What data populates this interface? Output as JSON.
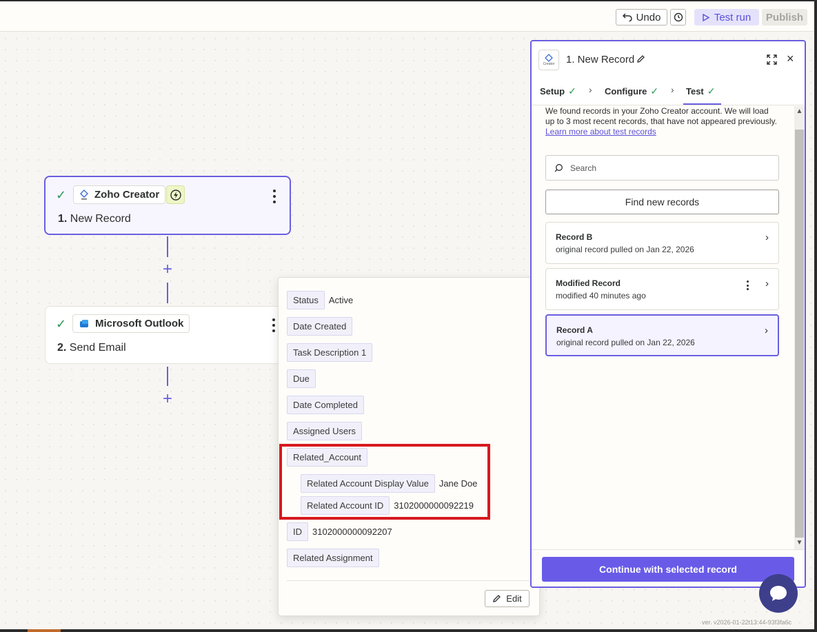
{
  "toolbar": {
    "undo_label": "Undo",
    "test_run_label": "Test run",
    "publish_label": "Publish"
  },
  "steps": [
    {
      "app_name": "Zoho Creator",
      "number": "1.",
      "title": "New Record"
    },
    {
      "app_name": "Microsoft Outlook",
      "number": "2.",
      "title": "Send Email"
    }
  ],
  "popover": {
    "fields": [
      {
        "label": "Status",
        "value": "Active"
      },
      {
        "label": "Date Created",
        "value": ""
      },
      {
        "label": "Task Description 1",
        "value": ""
      },
      {
        "label": "Due",
        "value": ""
      },
      {
        "label": "Date Completed",
        "value": ""
      },
      {
        "label": "Assigned Users",
        "value": ""
      },
      {
        "label": "Related_Account",
        "value": ""
      },
      {
        "label": "Related Account Display Value",
        "value": "Jane Doe"
      },
      {
        "label": "Related Account ID",
        "value": "3102000000092219"
      },
      {
        "label": "ID",
        "value": "3102000000092207"
      },
      {
        "label": "Related Assignment",
        "value": ""
      }
    ],
    "edit_label": "Edit"
  },
  "panel": {
    "app_logo_text": "Creator",
    "title": "1. New Record",
    "tabs": [
      {
        "label": "Setup"
      },
      {
        "label": "Configure"
      },
      {
        "label": "Test"
      }
    ],
    "intro_text": "We found records in your Zoho Creator account. We will load up to 3 most recent records, that have not appeared previously.",
    "learn_more_link": "Learn more about test records",
    "search_placeholder": "Search",
    "find_button": "Find new records",
    "records": [
      {
        "title": "Record B",
        "subtitle": "original record pulled on Jan 22, 2026",
        "selected": false
      },
      {
        "title": "Modified Record",
        "subtitle": "modified 40 minutes ago",
        "selected": false
      },
      {
        "title": "Record A",
        "subtitle": "original record pulled on Jan 22, 2026",
        "selected": true
      }
    ],
    "continue_button": "Continue with selected record"
  },
  "version_text": "ver. v2026-01-22t13:44-93f3fa6c",
  "colors": {
    "accent": "#6a5ee0",
    "primary_button": "#695be8",
    "success": "#2e9a57",
    "highlight": "#d7191f"
  }
}
